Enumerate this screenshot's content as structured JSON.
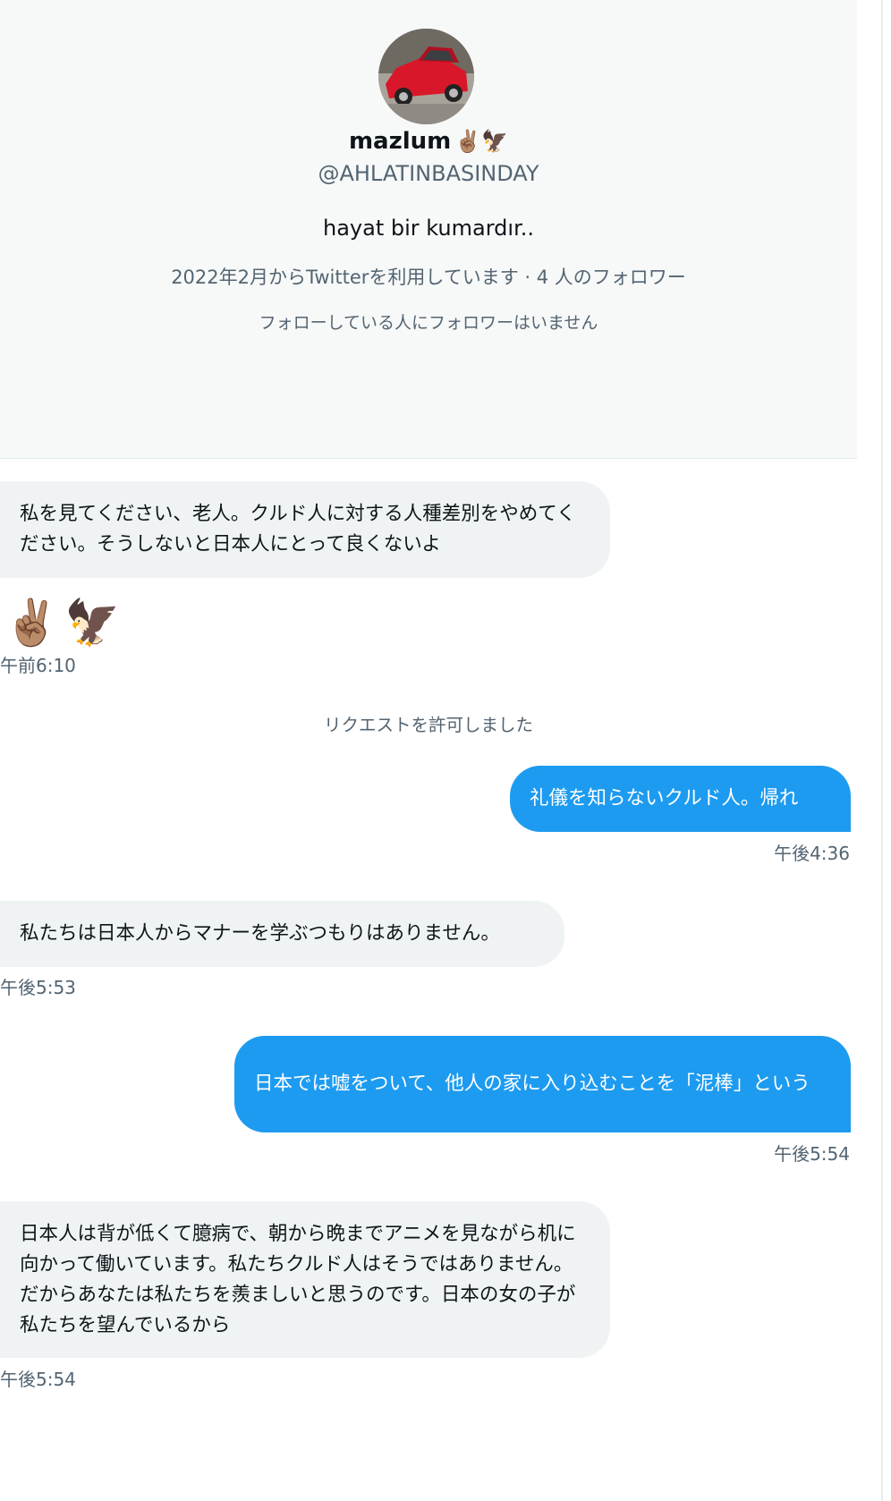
{
  "profile": {
    "name": "mazlum",
    "name_emoji": "✌🏽🦅",
    "handle": "@AHLATINBASINDAY",
    "bio": "hayat bir kumardır..",
    "joined_followers": "2022年2月からTwitterを利用しています · 4 人のフォロワー",
    "mutual_followers": "フォローしている人にフォロワーはいません"
  },
  "messages": [
    {
      "direction": "in",
      "text": "私を見てください、老人。クルド人に対する人種差別をやめてください。そうしないと日本人にとって良くないよ"
    },
    {
      "direction": "in",
      "text": "✌🏽🦅",
      "time": "午前6:10"
    },
    {
      "direction": "out",
      "text": "礼儀を知らないクルド人。帰れ",
      "time": "午後4:36"
    },
    {
      "direction": "in",
      "text": "私たちは日本人からマナーを学ぶつもりはありません。",
      "time": "午後5:53"
    },
    {
      "direction": "out",
      "text": "日本では嘘をついて、他人の家に入り込むことを「泥棒」という",
      "time": "午後5:54"
    },
    {
      "direction": "in",
      "text": "日本人は背が低くて臆病で、朝から晩までアニメを見ながら机に向かって働いています。私たちクルド人はそうではありません。だからあなたは私たちを羨ましいと思うのです。日本の女の子が私たちを望んでいるから",
      "time": "午後5:54"
    }
  ],
  "system": {
    "request_accepted": "リクエストを許可しました"
  },
  "colors": {
    "accent": "#1d9bf0",
    "incoming_bubble": "#eff3f4",
    "profile_bg": "#f7f9f9",
    "muted_text": "#536471"
  }
}
